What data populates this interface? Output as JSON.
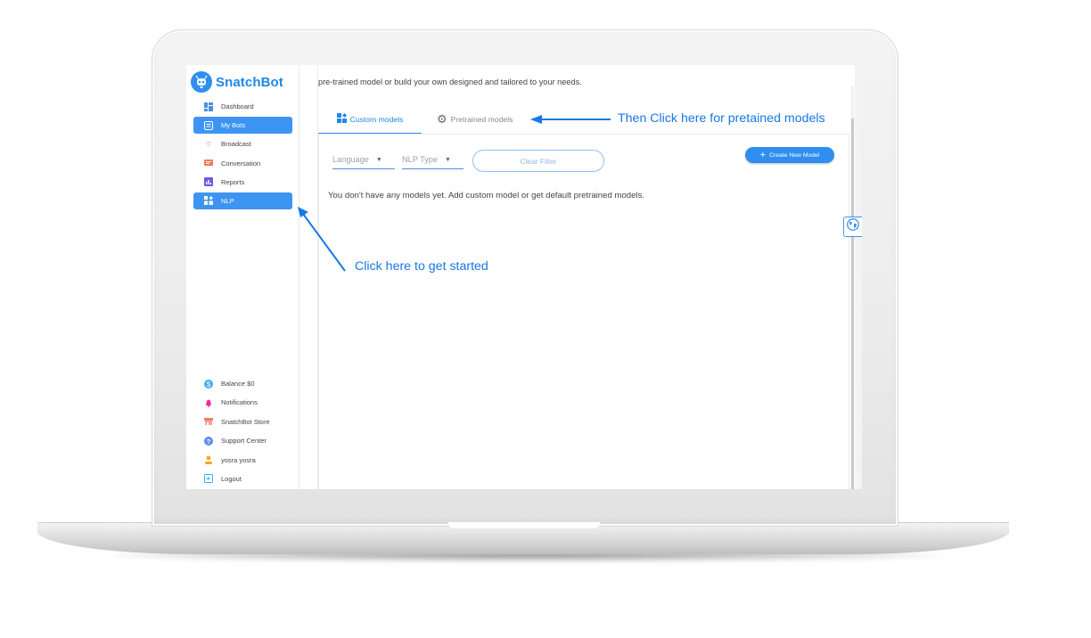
{
  "app": {
    "name": "SnatchBot"
  },
  "sidebar": {
    "items": [
      {
        "label": "Dashboard",
        "icon": "dashboard-icon",
        "active": false
      },
      {
        "label": "My Bots",
        "icon": "bots-icon",
        "active": true
      },
      {
        "label": "Broadcast",
        "icon": "broadcast-icon",
        "active": false
      },
      {
        "label": "Conversation",
        "icon": "conversation-icon",
        "active": false
      },
      {
        "label": "Reports",
        "icon": "reports-icon",
        "active": false
      },
      {
        "label": "NLP",
        "icon": "nlp-icon",
        "active": true
      }
    ],
    "bottom_items": [
      {
        "label": "Balance $0",
        "icon": "balance-icon"
      },
      {
        "label": "Notifications",
        "icon": "bell-icon"
      },
      {
        "label": "SnatchBot Store",
        "icon": "store-icon"
      },
      {
        "label": "Support Center",
        "icon": "help-icon"
      },
      {
        "label": "yosra yosra",
        "icon": "user-icon"
      },
      {
        "label": "Logout",
        "icon": "logout-icon"
      }
    ]
  },
  "main": {
    "intro": "pre-trained model or build your own designed and tailored to your needs.",
    "tabs": [
      {
        "label": "Custom models",
        "icon": "custom-models-icon",
        "active": true
      },
      {
        "label": "Pretrained models",
        "icon": "gear-icon",
        "active": false
      }
    ],
    "filters": {
      "language": {
        "placeholder": "Language"
      },
      "nlp_type": {
        "placeholder": "NLP Type"
      },
      "clear_label": "Clear Filter"
    },
    "create_button": "Create New Model",
    "empty_message": "You don't have any models yet. Add custom model or get default pretrained models."
  },
  "annotations": {
    "pretrained_hint": "Then Click here for pretained models",
    "start_hint": "Click here to get started"
  },
  "colors": {
    "accent": "#2f8ef0",
    "annotation": "#1677e6",
    "brand_text": "#1e88e5"
  }
}
